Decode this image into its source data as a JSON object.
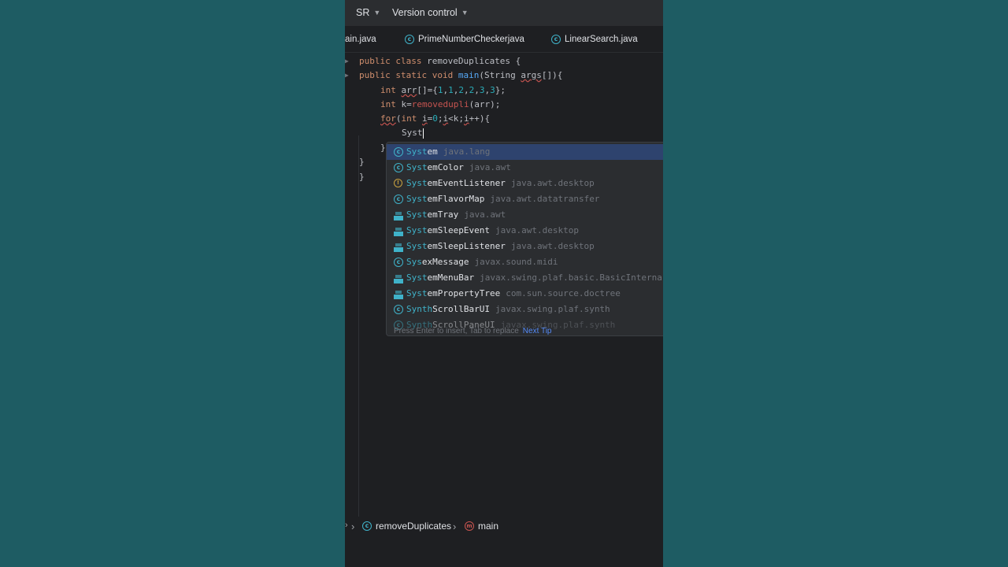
{
  "topbar": {
    "project": "SR",
    "vcs": "Version control"
  },
  "tabs": [
    {
      "label": "ain.java"
    },
    {
      "label": "PrimeNumberCheckerjava"
    },
    {
      "label": "LinearSearch.java"
    }
  ],
  "code": {
    "l1_kw": "public class ",
    "l1_rest": "removeDuplicates {",
    "l2_kw": "public static void ",
    "l2_fn": "main",
    "l2_rest": "(String ",
    "l2_var": "args",
    "l2_end": "[]){",
    "l3_kw": "int ",
    "l3_var": "arr",
    "l3_a": "[]={",
    "l3_n1": "1",
    "l3_n2": "1",
    "l3_n3": "2",
    "l3_n4": "2",
    "l3_n5": "3",
    "l3_n6": "3",
    "l3_end": "};",
    "l4_kw": "int ",
    "l4_a": "k=",
    "l4_call": "removedupli",
    "l4_end": "(arr);",
    "l5_kw": "for",
    "l5_a": "(",
    "l5_kw2": "int ",
    "l5_var": "i",
    "l5_b": "=",
    "l5_n": "0",
    "l5_c": ";",
    "l5_var2": "i",
    "l5_d": "<k;",
    "l5_var3": "i",
    "l5_end": "++){",
    "l6_text": "Syst",
    "l7": "}",
    "l8": "}",
    "l9": "}"
  },
  "completion": {
    "items": [
      {
        "match": "Syst",
        "rest": "em",
        "pkg": "java.lang",
        "icon": "class-icon"
      },
      {
        "match": "Syst",
        "rest": "emColor",
        "pkg": "java.awt",
        "icon": "class-icon"
      },
      {
        "match": "Syst",
        "rest": "emEventListener",
        "pkg": "java.awt.desktop",
        "icon": "interface-icon"
      },
      {
        "match": "Syst",
        "rest": "emFlavorMap",
        "pkg": "java.awt.datatransfer",
        "icon": "class-icon"
      },
      {
        "match": "Syst",
        "rest": "emTray",
        "pkg": "java.awt",
        "icon": "final-class-icon"
      },
      {
        "match": "Syst",
        "rest": "emSleepEvent",
        "pkg": "java.awt.desktop",
        "icon": "final-class-icon"
      },
      {
        "match": "Syst",
        "rest": "emSleepListener",
        "pkg": "java.awt.desktop",
        "icon": "final-class-icon"
      },
      {
        "match": "Sys",
        "rest": "exMessage",
        "pkg": "javax.sound.midi",
        "icon": "class-icon"
      },
      {
        "match": "Syst",
        "rest": "emMenuBar",
        "pkg": "javax.swing.plaf.basic.BasicInterna",
        "icon": "final-class-icon"
      },
      {
        "match": "Syst",
        "rest": "emPropertyTree",
        "pkg": "com.sun.source.doctree",
        "icon": "final-class-icon"
      },
      {
        "match": "Synth",
        "rest": "ScrollBarUI",
        "pkg": "javax.swing.plaf.synth",
        "icon": "class-icon"
      },
      {
        "match": "Synth",
        "rest": "ScrollPaneUI",
        "pkg": "javax.swing.plaf.synth",
        "icon": "class-icon"
      }
    ],
    "footer": "Press Enter to insert, Tab to replace",
    "next_tip": "Next Tip"
  },
  "statusbar": {
    "class": "removeDuplicates",
    "method": "main"
  },
  "colors": {
    "background": "#1e5c63",
    "editor_bg": "#1e1f22",
    "keyword": "#cf8e6d",
    "number": "#2aacb8",
    "method_call": "#c75450",
    "selection": "#2e436e"
  }
}
